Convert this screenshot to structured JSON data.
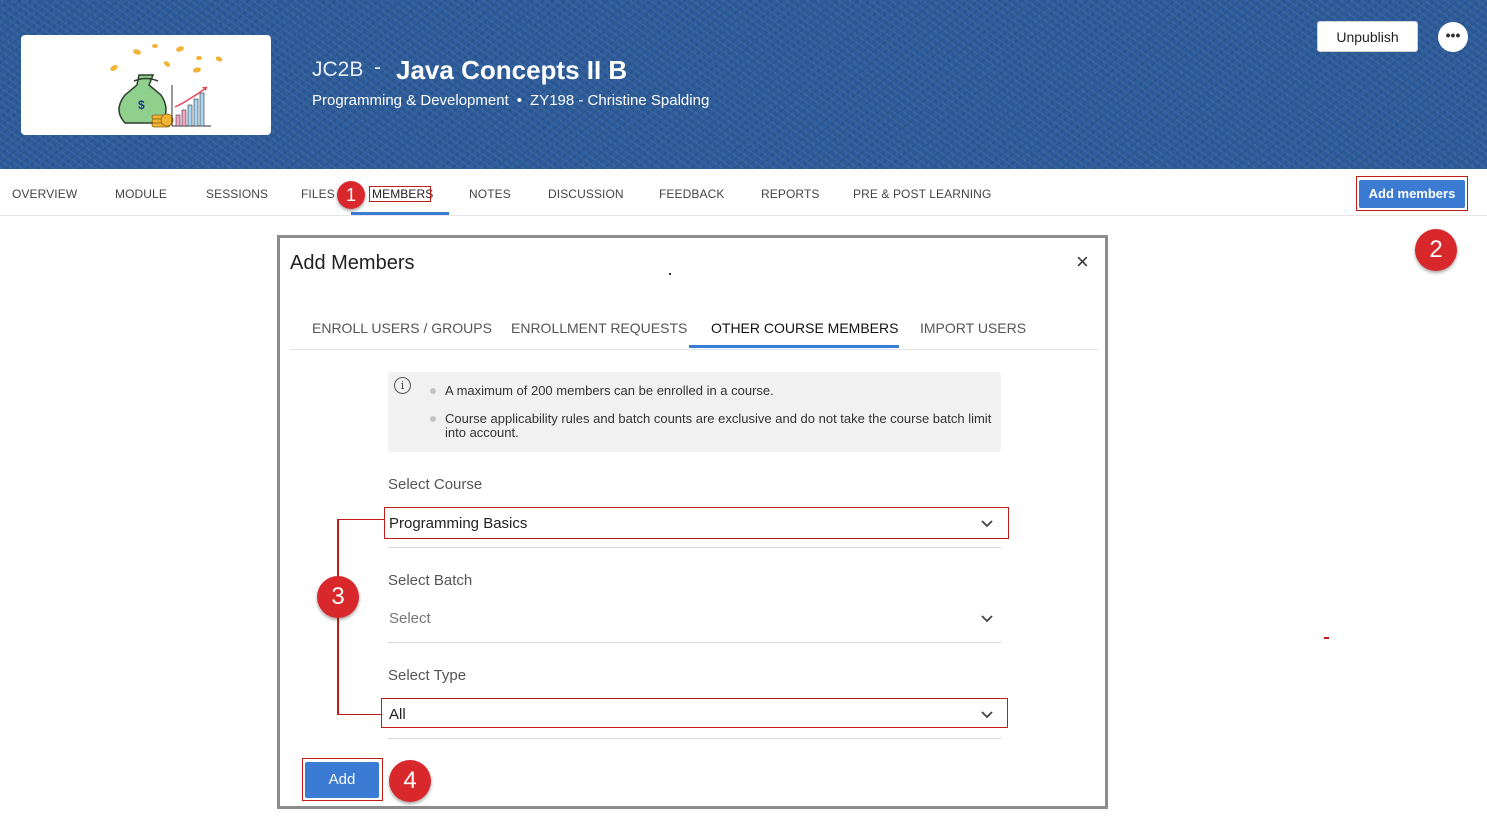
{
  "header": {
    "course_code": "JC2B",
    "separator": "-",
    "course_title": "Java Concepts II B",
    "category": "Programming & Development",
    "bullet": "•",
    "instructor": "ZY198 - Christine Spalding",
    "unpublish_label": "Unpublish",
    "more_label": "•••",
    "thumbnail_icon": "money-bag-growth-icon"
  },
  "nav": {
    "items": [
      {
        "label": "OVERVIEW"
      },
      {
        "label": "MODULE"
      },
      {
        "label": "SESSIONS"
      },
      {
        "label": "FILES"
      },
      {
        "label": "MEMBERS"
      },
      {
        "label": "NOTES"
      },
      {
        "label": "DISCUSSION"
      },
      {
        "label": "FEEDBACK"
      },
      {
        "label": "REPORTS"
      },
      {
        "label": "PRE & POST LEARNING"
      }
    ],
    "active": "MEMBERS",
    "add_members_label": "Add members"
  },
  "steps": [
    "1",
    "2",
    "3",
    "4"
  ],
  "dialog": {
    "title": "Add Members",
    "close_label": "×",
    "tabs": [
      {
        "label": "ENROLL USERS / GROUPS"
      },
      {
        "label": "ENROLLMENT REQUESTS"
      },
      {
        "label": "OTHER COURSE MEMBERS"
      },
      {
        "label": "IMPORT USERS"
      }
    ],
    "active_tab": "OTHER COURSE MEMBERS",
    "info_icon": "i",
    "info": [
      "A maximum of 200 members can be enrolled in a course.",
      "Course applicability rules and batch counts are exclusive and do not take the course batch limit into account."
    ],
    "fields": {
      "course": {
        "label": "Select Course",
        "value": "Programming Basics"
      },
      "batch": {
        "label": "Select Batch",
        "placeholder": "Select"
      },
      "type": {
        "label": "Select Type",
        "value": "All"
      }
    },
    "add_label": "Add"
  },
  "colors": {
    "primary": "#3b7bd4",
    "banner": "#2b5a98",
    "annotation_red": "#c21b1b",
    "badge_red": "#d9282b"
  }
}
